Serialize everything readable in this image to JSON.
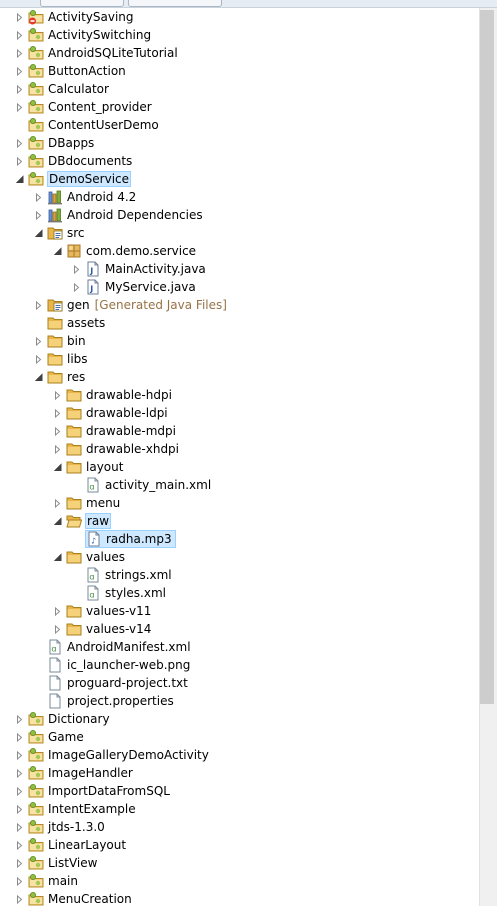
{
  "tabs": [
    "",
    ""
  ],
  "tree": [
    {
      "label": "ActivitySaving",
      "icon": "android-project-error",
      "twisty": "collapsed",
      "depth": 0
    },
    {
      "label": "ActivitySwitching",
      "icon": "android-project",
      "twisty": "collapsed",
      "depth": 0
    },
    {
      "label": "AndroidSQLiteTutorial",
      "icon": "android-project",
      "twisty": "collapsed",
      "depth": 0
    },
    {
      "label": "ButtonAction",
      "icon": "android-project",
      "twisty": "collapsed",
      "depth": 0
    },
    {
      "label": "Calculator",
      "icon": "android-project",
      "twisty": "collapsed",
      "depth": 0
    },
    {
      "label": "Content_provider",
      "icon": "android-project",
      "twisty": "collapsed",
      "depth": 0
    },
    {
      "label": "ContentUserDemo",
      "icon": "android-project",
      "twisty": "none",
      "depth": 0
    },
    {
      "label": "DBapps",
      "icon": "android-project",
      "twisty": "collapsed",
      "depth": 0
    },
    {
      "label": "DBdocuments",
      "icon": "android-project",
      "twisty": "collapsed",
      "depth": 0
    },
    {
      "label": "DemoService",
      "icon": "android-project",
      "twisty": "expanded",
      "depth": 0,
      "selected": true
    },
    {
      "label": "Android 4.2",
      "icon": "library",
      "twisty": "collapsed",
      "depth": 1
    },
    {
      "label": "Android Dependencies",
      "icon": "library",
      "twisty": "collapsed",
      "depth": 1
    },
    {
      "label": "src",
      "icon": "source-folder",
      "twisty": "expanded",
      "depth": 1
    },
    {
      "label": "com.demo.service",
      "icon": "package",
      "twisty": "expanded",
      "depth": 2
    },
    {
      "label": "MainActivity.java",
      "icon": "java-file",
      "twisty": "collapsed",
      "depth": 3
    },
    {
      "label": "MyService.java",
      "icon": "java-file",
      "twisty": "collapsed",
      "depth": 3
    },
    {
      "label": "gen",
      "decoration": "[Generated Java Files]",
      "icon": "source-folder",
      "twisty": "collapsed",
      "depth": 1
    },
    {
      "label": "assets",
      "icon": "folder",
      "twisty": "none",
      "depth": 1
    },
    {
      "label": "bin",
      "icon": "folder",
      "twisty": "collapsed",
      "depth": 1
    },
    {
      "label": "libs",
      "icon": "folder",
      "twisty": "collapsed",
      "depth": 1
    },
    {
      "label": "res",
      "icon": "folder",
      "twisty": "expanded",
      "depth": 1
    },
    {
      "label": "drawable-hdpi",
      "icon": "folder",
      "twisty": "collapsed",
      "depth": 2
    },
    {
      "label": "drawable-ldpi",
      "icon": "folder",
      "twisty": "collapsed",
      "depth": 2
    },
    {
      "label": "drawable-mdpi",
      "icon": "folder",
      "twisty": "collapsed",
      "depth": 2
    },
    {
      "label": "drawable-xhdpi",
      "icon": "folder",
      "twisty": "collapsed",
      "depth": 2
    },
    {
      "label": "layout",
      "icon": "folder",
      "twisty": "expanded",
      "depth": 2
    },
    {
      "label": "activity_main.xml",
      "icon": "xml-file",
      "twisty": "none",
      "depth": 3
    },
    {
      "label": "menu",
      "icon": "folder",
      "twisty": "collapsed",
      "depth": 2
    },
    {
      "label": "raw",
      "icon": "folder-open",
      "twisty": "expanded",
      "depth": 2,
      "selected": true
    },
    {
      "label": "radha.mp3",
      "icon": "audio-file",
      "twisty": "none",
      "depth": 3,
      "selected": true,
      "boxed": true
    },
    {
      "label": "values",
      "icon": "folder",
      "twisty": "expanded",
      "depth": 2
    },
    {
      "label": "strings.xml",
      "icon": "xml-file",
      "twisty": "none",
      "depth": 3
    },
    {
      "label": "styles.xml",
      "icon": "xml-file",
      "twisty": "none",
      "depth": 3
    },
    {
      "label": "values-v11",
      "icon": "folder",
      "twisty": "collapsed",
      "depth": 2
    },
    {
      "label": "values-v14",
      "icon": "folder",
      "twisty": "collapsed",
      "depth": 2
    },
    {
      "label": "AndroidManifest.xml",
      "icon": "xml-file",
      "twisty": "none",
      "depth": 1
    },
    {
      "label": "ic_launcher-web.png",
      "icon": "file",
      "twisty": "none",
      "depth": 1
    },
    {
      "label": "proguard-project.txt",
      "icon": "file",
      "twisty": "none",
      "depth": 1
    },
    {
      "label": "project.properties",
      "icon": "file",
      "twisty": "none",
      "depth": 1
    },
    {
      "label": "Dictionary",
      "icon": "android-project",
      "twisty": "collapsed",
      "depth": 0
    },
    {
      "label": "Game",
      "icon": "android-project",
      "twisty": "collapsed",
      "depth": 0
    },
    {
      "label": "ImageGalleryDemoActivity",
      "icon": "android-project",
      "twisty": "collapsed",
      "depth": 0
    },
    {
      "label": "ImageHandler",
      "icon": "android-project",
      "twisty": "collapsed",
      "depth": 0
    },
    {
      "label": "ImportDataFromSQL",
      "icon": "android-project",
      "twisty": "collapsed",
      "depth": 0
    },
    {
      "label": "IntentExample",
      "icon": "android-project",
      "twisty": "collapsed",
      "depth": 0
    },
    {
      "label": "jtds-1.3.0",
      "icon": "android-project",
      "twisty": "collapsed",
      "depth": 0
    },
    {
      "label": "LinearLayout",
      "icon": "android-project",
      "twisty": "collapsed",
      "depth": 0
    },
    {
      "label": "ListView",
      "icon": "android-project",
      "twisty": "collapsed",
      "depth": 0
    },
    {
      "label": "main",
      "icon": "android-project",
      "twisty": "collapsed",
      "depth": 0
    },
    {
      "label": "MenuCreation",
      "icon": "android-project",
      "twisty": "collapsed",
      "depth": 0
    }
  ],
  "colors": {
    "selection": "#cde8ff",
    "selection_border": "#99d1ff",
    "decoration": "#967346",
    "folder": "#e8b64a"
  }
}
